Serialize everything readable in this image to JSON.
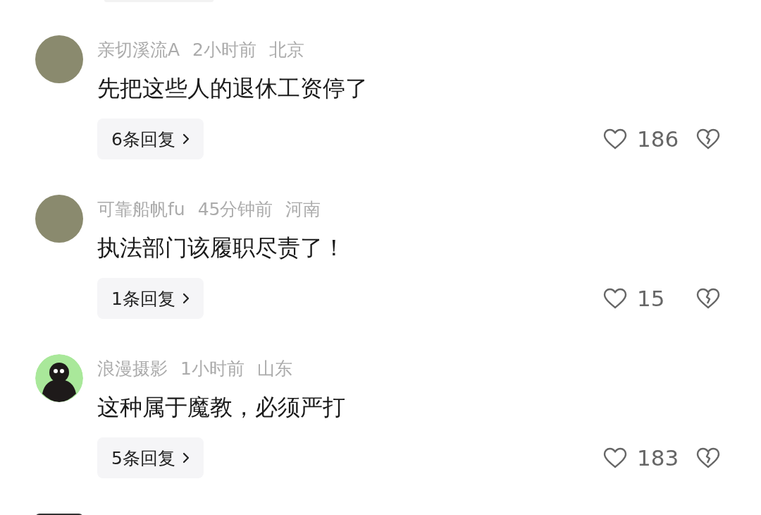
{
  "comments": [
    {
      "avatar": {
        "kind": "photo"
      },
      "username": "亲切溪流A",
      "time": "2小时前",
      "location": "北京",
      "text": "先把这些人的退休工资停了",
      "replies": "6条回复",
      "likes": "186"
    },
    {
      "avatar": {
        "kind": "photo"
      },
      "username": "可靠船帆fu",
      "time": "45分钟前",
      "location": "河南",
      "text": "执法部门该履职尽责了！",
      "replies": "1条回复",
      "likes": "15"
    },
    {
      "avatar": {
        "kind": "silhouette"
      },
      "username": "浪漫摄影",
      "time": "1小时前",
      "location": "山东",
      "text": "这种属于魔教，必须严打",
      "replies": "5条回复",
      "likes": "183"
    }
  ]
}
